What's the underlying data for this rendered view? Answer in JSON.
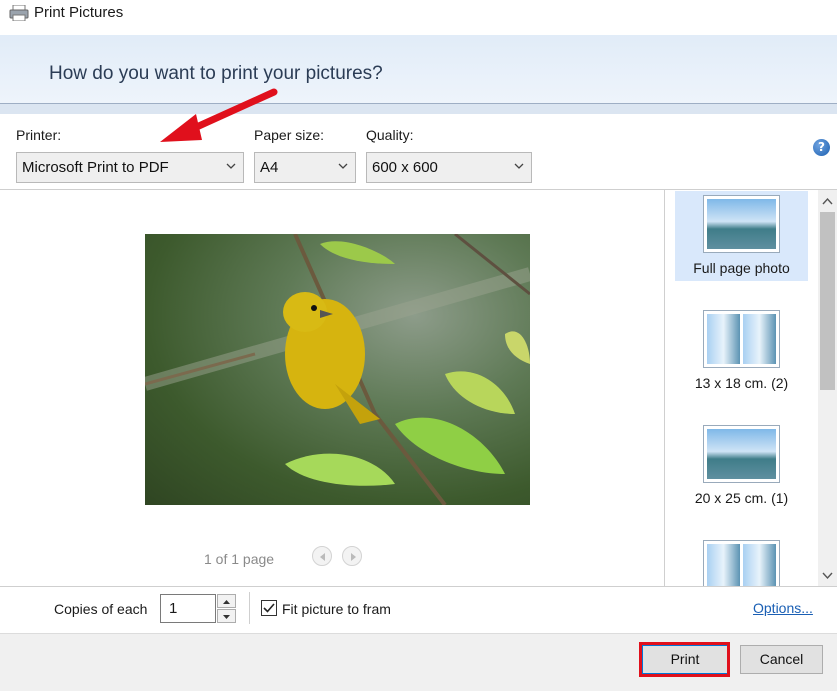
{
  "window": {
    "title": "Print Pictures"
  },
  "header": {
    "question": "How do you want to print your pictures?"
  },
  "settings": {
    "printer": {
      "label": "Printer:",
      "value": "Microsoft Print to PDF"
    },
    "paper_size": {
      "label": "Paper size:",
      "value": "A4"
    },
    "quality": {
      "label": "Quality:",
      "value": "600 x 600"
    }
  },
  "preview": {
    "page_info": "1 of 1 page"
  },
  "layouts": [
    {
      "caption": "Full page photo",
      "selected": true
    },
    {
      "caption": "13 x 18 cm. (2)",
      "selected": false
    },
    {
      "caption": "20 x 25 cm. (1)",
      "selected": false
    },
    {
      "caption": "",
      "selected": false
    }
  ],
  "copies": {
    "label": "Copies of each",
    "value": "1"
  },
  "fit": {
    "label": "Fit picture to fram",
    "checked": true
  },
  "options_link": "Options...",
  "buttons": {
    "print": "Print",
    "cancel": "Cancel"
  },
  "colors": {
    "accent": "#0078d7",
    "highlight": "#e0101c",
    "link": "#1a5fb4",
    "header_bg": "#e1ecf8"
  }
}
